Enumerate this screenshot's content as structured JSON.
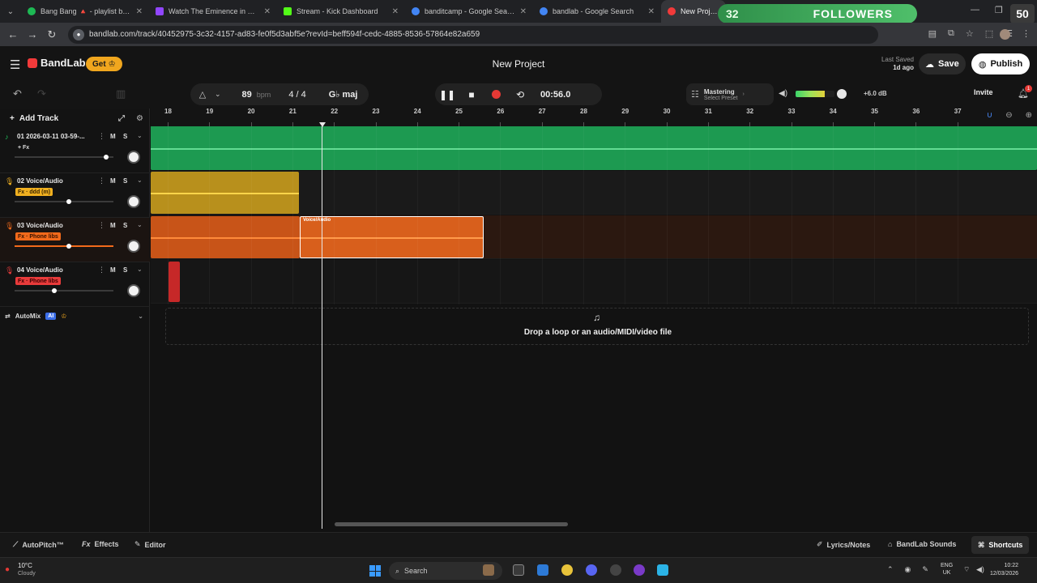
{
  "browser": {
    "tabs": [
      {
        "label": "Bang Bang 🔺 - playlist by aad",
        "color": "#1db954"
      },
      {
        "label": "Watch The Eminence in Shadow",
        "color": "#9146ff"
      },
      {
        "label": "Stream - Kick Dashboard",
        "color": "#53fc18"
      },
      {
        "label": "banditcamp - Google Search",
        "color": "#4285f4"
      },
      {
        "label": "bandlab - Google Search",
        "color": "#4285f4"
      },
      {
        "label": "New Project",
        "color": "#f23a3a"
      }
    ],
    "url": "bandlab.com/track/40452975-3c32-4157-ad83-fe0f5d3abf5e?revId=beff594f-cedc-4885-8536-57864e82a659"
  },
  "overlay": {
    "followers_count": "32",
    "followers_label": "FOLLOWERS",
    "goal": "50"
  },
  "header": {
    "logo": "BandLab",
    "get_label": "Get",
    "project_title": "New Project",
    "last_saved_label": "Last Saved",
    "last_saved_value": "1d ago",
    "save_label": "Save",
    "publish_label": "Publish"
  },
  "toolbar": {
    "bpm": "89",
    "bpm_unit": "bpm",
    "time_sig": "4 / 4",
    "key": "G♭ maj",
    "timecode": "00:56.0",
    "mastering_label": "Mastering",
    "mastering_preset": "Select Preset",
    "master_volume": "+6.0 dB",
    "meter_level": 0.75,
    "invite_label": "Invite",
    "notification_count": "1"
  },
  "tracks_panel": {
    "add_track_label": "Add Track",
    "mute_label": "M",
    "solo_label": "S",
    "tracks": [
      {
        "number": "01",
        "name": "2026-03-11 03-59-...",
        "fx": "+ Fx",
        "color": "#22c55e",
        "volume": 0.93
      },
      {
        "number": "02",
        "name": "Voice/Audio",
        "fx": "Fx · ddd (m)",
        "color": "#f0b020",
        "volume": 0.55
      },
      {
        "number": "03",
        "name": "Voice/Audio",
        "fx": "Fx · Phone libs",
        "color": "#f26a1b",
        "volume": 0.55
      },
      {
        "number": "04",
        "name": "Voice/Audio",
        "fx": "Fx · Phone libs",
        "color": "#e83b3b",
        "volume": 0.4
      }
    ],
    "automix_label": "AutoMix",
    "automix_badge": "AI"
  },
  "timeline": {
    "bars": [
      "18",
      "19",
      "20",
      "21",
      "22",
      "23",
      "24",
      "25",
      "26",
      "27",
      "28",
      "29",
      "30",
      "31",
      "32",
      "33",
      "34",
      "35",
      "36",
      "37"
    ],
    "region_label": "Voice/Audio",
    "drop_zone_text": "Drop a loop or an audio/MIDI/video file"
  },
  "footer": {
    "autopitch_label": "AutoPitch™",
    "effects_label": "Effects",
    "editor_label": "Editor",
    "lyrics_label": "Lyrics/Notes",
    "sounds_label": "BandLab Sounds",
    "shortcuts_label": "Shortcuts"
  },
  "taskbar": {
    "weather_temp": "10°C",
    "weather_cond": "Cloudy",
    "search_placeholder": "Search",
    "lang_top": "ENG",
    "lang_bottom": "UK",
    "time": "10:22",
    "date": "12/03/2026"
  }
}
